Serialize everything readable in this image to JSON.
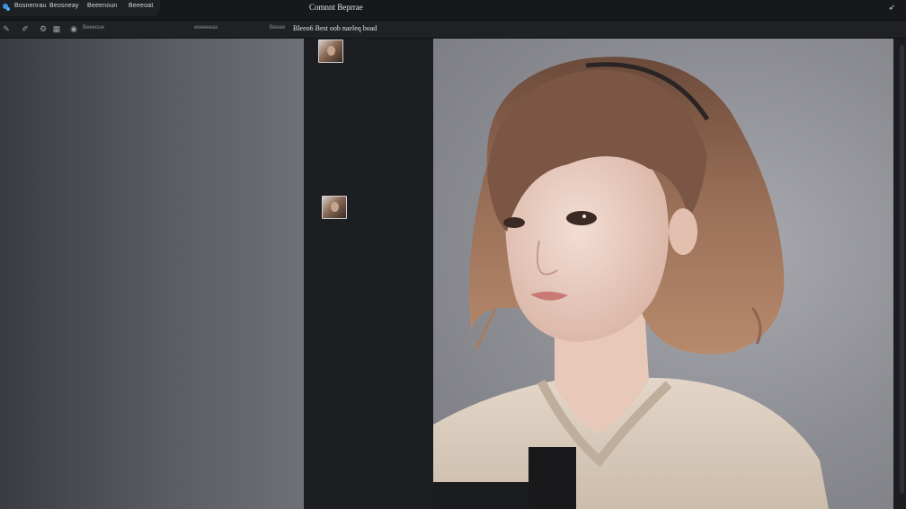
{
  "titlebar": {
    "tabs": [
      "Bosnenrau",
      "Beosneay",
      "Beeenoun",
      "Beeeoat"
    ],
    "window_title": "Comnnt Beprrae",
    "corner_icon": "cursor-icon"
  },
  "toolbar": {
    "icons": [
      "layers-icon",
      "brush-icon",
      "settings-icon",
      "grid-icon",
      "eye-icon"
    ],
    "text_left": "Beeeoue",
    "text_mid": "eeeeeeas",
    "text_right": "Beeee",
    "header_label": "Bleeo6 Best oob naeleq boad"
  },
  "thumbnails": [
    {
      "name": "portrait-thumbnail-1"
    },
    {
      "name": "portrait-thumbnail-2"
    }
  ],
  "image": {
    "subject": "portrait-photo"
  },
  "colors": {
    "titlebar_bg": "#17181b",
    "toolbar_bg": "#1f2125",
    "strip_bg": "#1d1e21",
    "accent_blue": "#3d8fe0"
  }
}
